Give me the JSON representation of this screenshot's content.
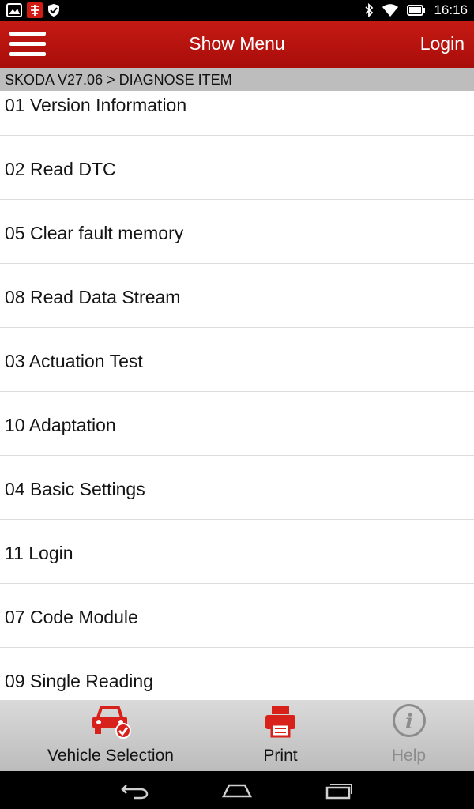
{
  "status_bar": {
    "time": "16:16",
    "left_icons": [
      "image-icon",
      "app-icon",
      "shield-icon"
    ],
    "right_icons": [
      "bluetooth-icon",
      "wifi-icon",
      "battery-icon"
    ]
  },
  "header": {
    "title": "Show Menu",
    "login_label": "Login"
  },
  "breadcrumb": "SKODA V27.06 > DIAGNOSE ITEM",
  "menu_items": [
    {
      "label": "01 Version Information"
    },
    {
      "label": "02 Read DTC"
    },
    {
      "label": "05 Clear fault memory"
    },
    {
      "label": "08 Read Data Stream"
    },
    {
      "label": "03 Actuation Test"
    },
    {
      "label": "10 Adaptation"
    },
    {
      "label": "04 Basic Settings"
    },
    {
      "label": "11 Login"
    },
    {
      "label": "07 Code Module"
    },
    {
      "label": "09 Single Reading"
    }
  ],
  "bottom_bar": {
    "vehicle_selection": "Vehicle Selection",
    "print": "Print",
    "help": "Help"
  },
  "colors": {
    "brand_red": "#b8120e",
    "breadcrumb_bg": "#bdbdbd",
    "disabled_gray": "#8c8c8c"
  }
}
